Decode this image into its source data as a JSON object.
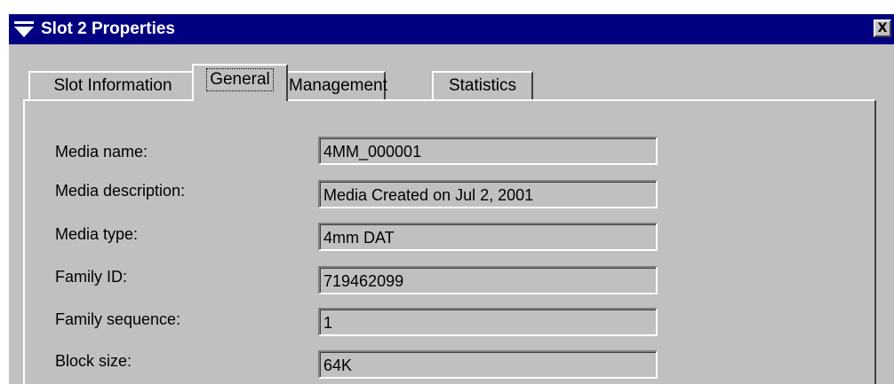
{
  "window": {
    "title": "Slot 2 Properties",
    "close_label": "X"
  },
  "tabs": [
    {
      "label": "Slot Information",
      "selected": false
    },
    {
      "label": "General",
      "selected": true
    },
    {
      "label": "Management",
      "selected": false
    },
    {
      "label": "Statistics",
      "selected": false
    }
  ],
  "fields": [
    {
      "label": "Media name:",
      "value": "4MM_000001"
    },
    {
      "label": "Media description:",
      "value": "Media Created on Jul 2, 2001"
    },
    {
      "label": "Media type:",
      "value": "4mm DAT"
    },
    {
      "label": "Family ID:",
      "value": "719462099"
    },
    {
      "label": "Family sequence:",
      "value": "1"
    },
    {
      "label": "Block size:",
      "value": "64K"
    }
  ],
  "colors": {
    "titlebar": "#000080",
    "face": "#c0c0c0"
  },
  "icons": {
    "title": "window-menu-icon",
    "close": "close-icon"
  }
}
